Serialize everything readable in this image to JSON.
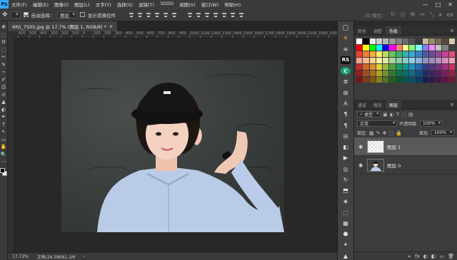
{
  "app": {
    "logo": "Ps"
  },
  "menu": [
    "文件(F)",
    "编辑(E)",
    "图像(I)",
    "图层(L)",
    "文字(Y)",
    "选择(S)",
    "滤镜(T)",
    "3D(D)",
    "视图(V)",
    "窗口(W)",
    "帮助(H)"
  ],
  "window_controls": {
    "minimize": "—",
    "maximize": "□",
    "close": "✕"
  },
  "options": {
    "auto_select_label": "自动选择：",
    "auto_select_checked": true,
    "auto_select_target": "图层",
    "show_transform_label": "显示变换控件",
    "show_transform_checked": false,
    "mode_3d_label": "3D 模式："
  },
  "document": {
    "tab_title": "IMG_7505.jpg @ 17.7% (图层 1, RGB/8) *",
    "close": "×"
  },
  "ruler": {
    "ticks": [
      "600",
      "500",
      "400",
      "300",
      "200",
      "100",
      "0",
      "100",
      "200",
      "300",
      "400",
      "500",
      "600",
      "700",
      "800",
      "900",
      "1000",
      "1100",
      "1200",
      "1300",
      "1400",
      "1500",
      "1600",
      "1700",
      "1800",
      "1900",
      "2000",
      "2100",
      "2200",
      "2300",
      "2400"
    ]
  },
  "status": {
    "zoom": "17.72%",
    "doc_size": "文档:26.5M/61.1M",
    "arrow": "›"
  },
  "color_panel": {
    "tabs": [
      "颜色",
      "调整",
      "色板"
    ],
    "active_tab": "色板",
    "rows": [
      [
        "#ffffff",
        "#000000",
        "#e8e8e8",
        "#cfcfcf",
        "#b6b6b6",
        "#9c9c9c",
        "#838383",
        "#6a6a6a",
        "#515151",
        "#383838",
        "#c8b89a",
        "#9c8a6a",
        "#776a54",
        "#544a3a",
        "#d6c9a6"
      ],
      [
        "#ff0000",
        "#ffff00",
        "#00ff00",
        "#00ffff",
        "#0000ff",
        "#ff00ff",
        "#ff8080",
        "#ffff80",
        "#80ff80",
        "#80ffff",
        "#8080ff",
        "#ff80ff",
        "#c0c0c0",
        "#808080",
        "#404040"
      ],
      [
        "#ee4433",
        "#f07b3a",
        "#f9ad3b",
        "#fff26a",
        "#b9dc5b",
        "#6cc35b",
        "#3bb479",
        "#2eb3a9",
        "#36a9d8",
        "#3881c3",
        "#4a59a6",
        "#6a4b9c",
        "#92479a",
        "#c14394",
        "#e94a7a"
      ],
      [
        "#f5a28e",
        "#f7b98e",
        "#fbd38d",
        "#fff7a1",
        "#dcea9c",
        "#a8d79b",
        "#8acfa7",
        "#86d0cb",
        "#8ad0ef",
        "#8bb1dc",
        "#8d95c8",
        "#a28dc3",
        "#bd8bc1",
        "#dc8bc0",
        "#f29cb4"
      ],
      [
        "#c9272c",
        "#d2642a",
        "#d98f2b",
        "#e0d435",
        "#98bd3d",
        "#47a542",
        "#1a9960",
        "#119691",
        "#1b90c2",
        "#1f6aad",
        "#2f3f8f",
        "#503686",
        "#78307f",
        "#a12f7d",
        "#cb3062"
      ],
      [
        "#9a1b1f",
        "#a14e1f",
        "#a6701f",
        "#aca327",
        "#72902d",
        "#307b32",
        "#0b7247",
        "#066f6b",
        "#0d6b90",
        "#124e81",
        "#1e2c6b",
        "#3b2463",
        "#5a1e5e",
        "#79205c",
        "#992047"
      ],
      [
        "#7a1315",
        "#7e3c15",
        "#825815",
        "#86801b",
        "#587021",
        "#215f24",
        "#045735",
        "#005452",
        "#06526f",
        "#0a3b63",
        "#131e52",
        "#2b194b",
        "#451448",
        "#5d1646",
        "#771635"
      ]
    ]
  },
  "layers_panel": {
    "tabs": [
      "通道",
      "路径",
      "图层"
    ],
    "active_tab": "图层",
    "filter_label": "类型",
    "blend_mode": "正常",
    "opacity_label": "不透明度:",
    "opacity_value": "100%",
    "lock_label": "锁定:",
    "fill_label": "填充:",
    "fill_value": "100%",
    "layers": [
      {
        "name": "图层 1",
        "selected": true,
        "thumb": "transparent"
      },
      {
        "name": "图层 0",
        "selected": false,
        "thumb": "photo"
      }
    ],
    "footer_icons": [
      "∞",
      "fx",
      "◐",
      "◧",
      "▭",
      "🗑"
    ]
  },
  "tools": [
    "✥",
    "⬚",
    "ʘ",
    "⬚",
    "✂",
    "✎",
    "⌁",
    "✐",
    "⎙",
    "⊙",
    "▲",
    "◐",
    "✒",
    "T",
    "↖",
    "▭",
    "✋",
    "🔍",
    "⋯"
  ],
  "strip_icons": [
    "◯",
    "✕",
    "≋",
    "RS",
    "C",
    "≣",
    "⊞",
    "Ａ",
    "¶",
    "¶",
    "⊟",
    "◧",
    "▶",
    "◎",
    "↻",
    "⬒",
    "◈",
    "⬚",
    "▦",
    "⬣",
    "✦",
    "▲"
  ]
}
